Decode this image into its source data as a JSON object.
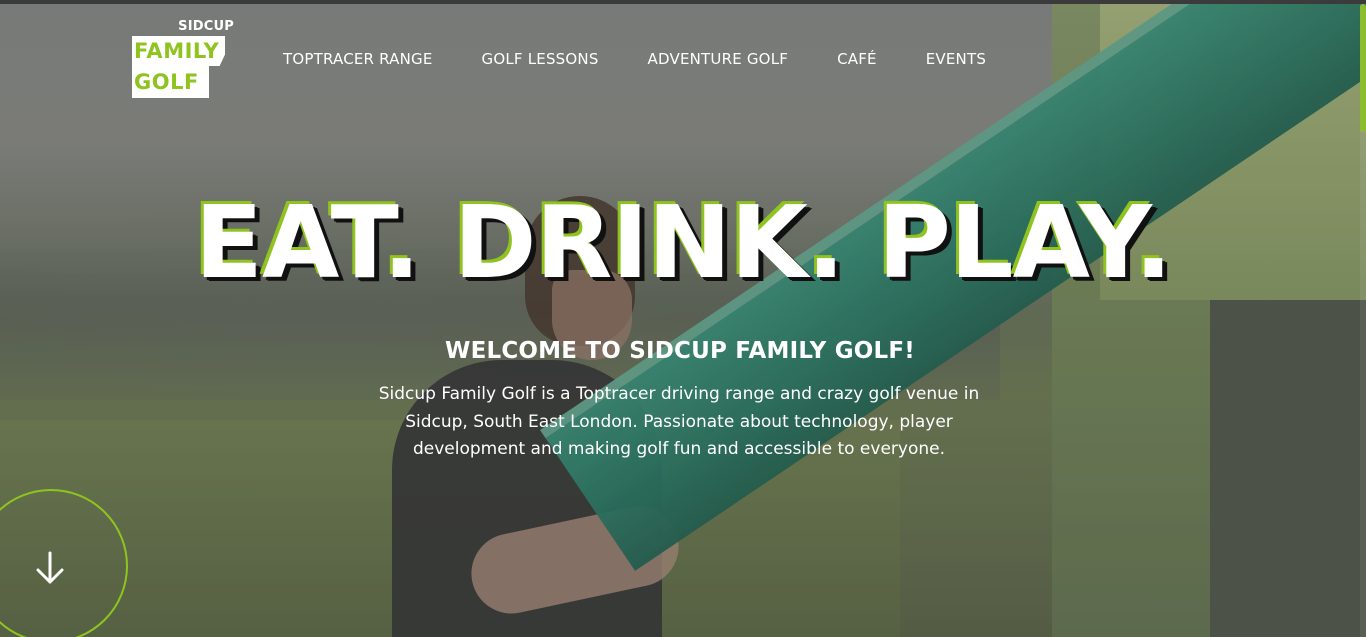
{
  "logo": {
    "line1": "SIDCUP",
    "line2": "FAMILY",
    "line3": "GOLF"
  },
  "nav": {
    "items": [
      {
        "label": "TOPTRACER RANGE"
      },
      {
        "label": "GOLF LESSONS"
      },
      {
        "label": "ADVENTURE GOLF"
      },
      {
        "label": "CAFÉ"
      },
      {
        "label": "EVENTS"
      }
    ]
  },
  "hero": {
    "headline": "EAT. DRINK. PLAY.",
    "welcome": "WELCOME TO SIDCUP FAMILY GOLF!",
    "description": "Sidcup Family Golf is a Toptracer driving range and crazy golf venue in Sidcup, South East London. Passionate about technology, player development and making golf fun and accessible to everyone."
  },
  "scroll_down": {
    "icon": "arrow-down-icon"
  },
  "colors": {
    "accent": "#8fc31f",
    "text": "#ffffff",
    "outline_dark": "#111111"
  }
}
